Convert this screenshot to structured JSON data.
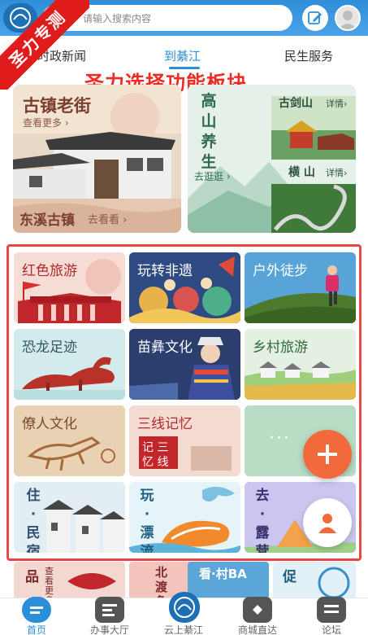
{
  "ribbon": "圣力专测",
  "search": {
    "placeholder": "请输入搜索内容"
  },
  "tabs": [
    {
      "label": "时政新闻",
      "active": false
    },
    {
      "label": "到綦江",
      "active": true
    },
    {
      "label": "民生服务",
      "active": false
    }
  ],
  "annotation": "圣力选择功能板块",
  "feature_left": {
    "title": "古镇老街",
    "more": "查看更多 ›",
    "sign": "东溪古镇",
    "sign_more": "去看看 ›"
  },
  "feature_right": {
    "vertical_title": "高山养生",
    "go": "去逛逛 ›",
    "spot1": "古剑山",
    "spot1_more": "详情›",
    "spot2": "横 山",
    "spot2_more": "详情›"
  },
  "grid": [
    {
      "label": "红色旅游"
    },
    {
      "label": "玩转非遗"
    },
    {
      "label": "户外徒步"
    },
    {
      "label": "恐龙足迹"
    },
    {
      "label": "苗彝文化"
    },
    {
      "label": "乡村旅游"
    },
    {
      "label": "僚人文化"
    },
    {
      "label": "三线记忆"
    },
    {
      "label": "···"
    },
    {
      "label": "住·民宿"
    },
    {
      "label": "玩·漂流"
    },
    {
      "label": "去·露营"
    }
  ],
  "strip": [
    {
      "label": "品",
      "sub": "查看更多"
    },
    {
      "label": "北渡鱼"
    },
    {
      "label": "看·村BA"
    },
    {
      "label": "促"
    }
  ],
  "bottom_nav": [
    {
      "label": "首页",
      "active": true
    },
    {
      "label": "办事大厅",
      "active": false
    },
    {
      "label": "云上綦江",
      "active": false
    },
    {
      "label": "商城直达",
      "active": false
    },
    {
      "label": "论坛",
      "active": false
    }
  ],
  "colors": {
    "brand_blue": "#2a8fd8",
    "ribbon_red": "#e01b1b",
    "annotation_red": "#ee2a24",
    "fab_orange": "#f26a3c"
  }
}
